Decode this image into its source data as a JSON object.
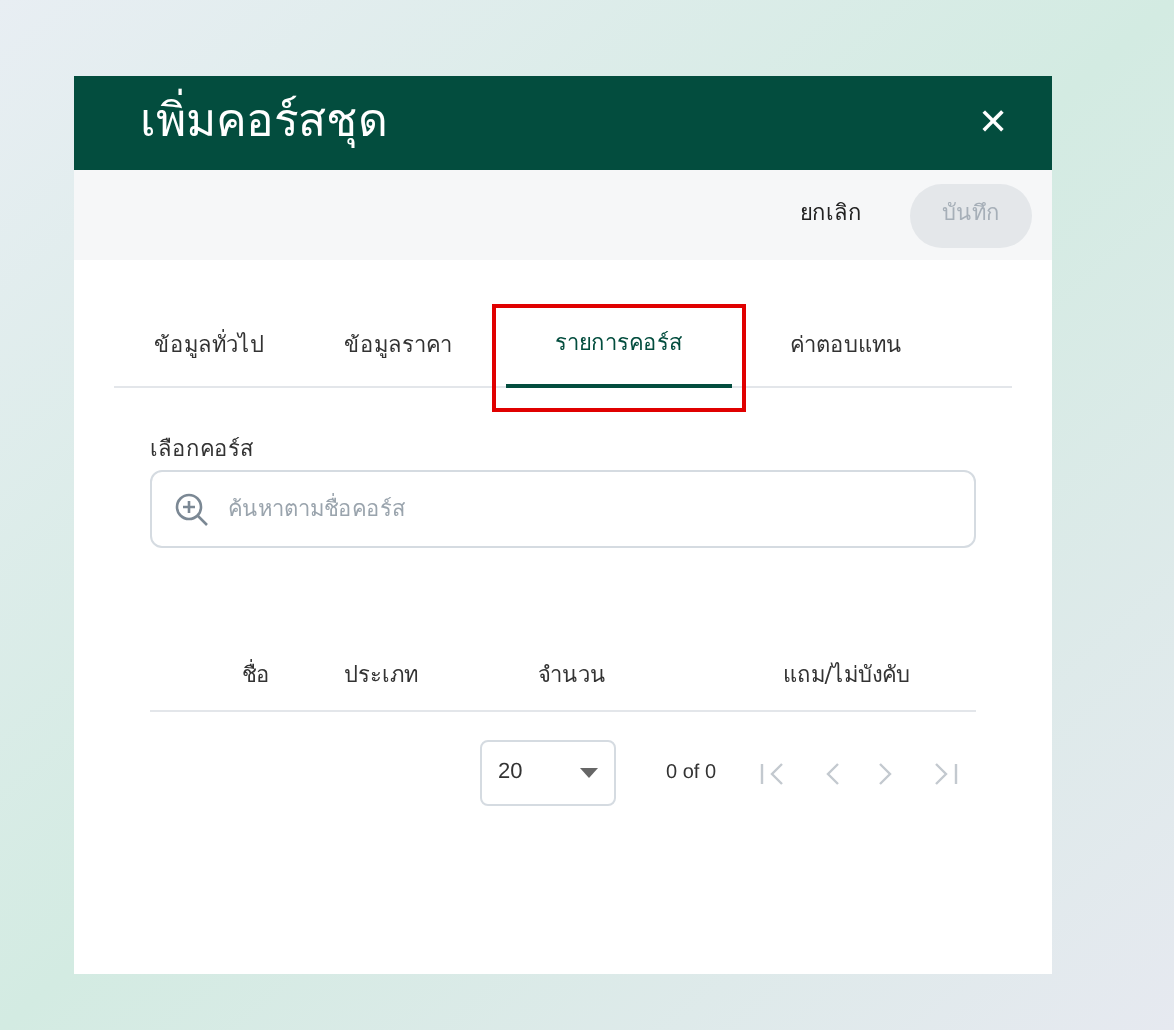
{
  "dialog": {
    "title": "เพิ่มคอร์สชุด",
    "close": "✕"
  },
  "toolbar": {
    "buttons": [
      {
        "label": "ยกเลิก",
        "disabled": false
      },
      {
        "label": "บันทึก",
        "disabled": true
      }
    ]
  },
  "tabs": [
    {
      "label": "ข้อมูลทั่วไป",
      "selected": false,
      "highlighted": false
    },
    {
      "label": "ข้อมูลราคา",
      "selected": false,
      "highlighted": false
    },
    {
      "label": "รายการคอร์ส",
      "selected": true,
      "highlighted": true
    },
    {
      "label": "ค่าตอบแทน",
      "selected": false,
      "highlighted": false
    }
  ],
  "course_select": {
    "label": "เลือกคอร์ส",
    "placeholder": "ค้นหาตามชื่อคอร์ส"
  },
  "table": {
    "columns": [
      "ชื่อ",
      "ประเภท",
      "จำนวน",
      "แถม/ไม่บังคับ"
    ]
  },
  "pagination": {
    "page_size": "20",
    "range": "0 of 0"
  }
}
